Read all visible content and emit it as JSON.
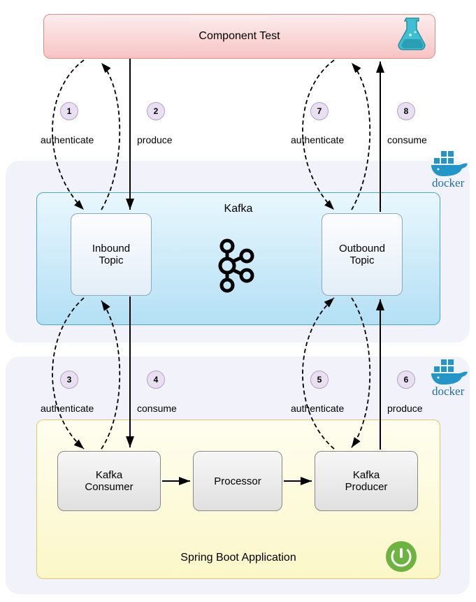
{
  "component_test": {
    "title": "Component Test"
  },
  "kafka": {
    "title": "Kafka",
    "inbound": "Inbound Topic",
    "outbound": "Outbound Topic"
  },
  "spring": {
    "title": "Spring Boot Application",
    "consumer": "Kafka Consumer",
    "processor": "Processor",
    "producer": "Kafka Producer"
  },
  "docker_label_top": "docker",
  "docker_label_bottom": "docker",
  "steps": {
    "s1": {
      "num": "1",
      "label": "authenticate"
    },
    "s2": {
      "num": "2",
      "label": "produce"
    },
    "s3": {
      "num": "3",
      "label": "authenticate"
    },
    "s4": {
      "num": "4",
      "label": "consume"
    },
    "s5": {
      "num": "5",
      "label": "authenticate"
    },
    "s6": {
      "num": "6",
      "label": "produce"
    },
    "s7": {
      "num": "7",
      "label": "authenticate"
    },
    "s8": {
      "num": "8",
      "label": "consume"
    }
  },
  "colors": {
    "component_border": "#e58a8a",
    "kafka_border": "#4aa8d8",
    "spring_border": "#d8cc6a",
    "badge_bg": "#e8dff0",
    "docker_blue": "#1f6fa3",
    "spring_green": "#6db33f"
  }
}
